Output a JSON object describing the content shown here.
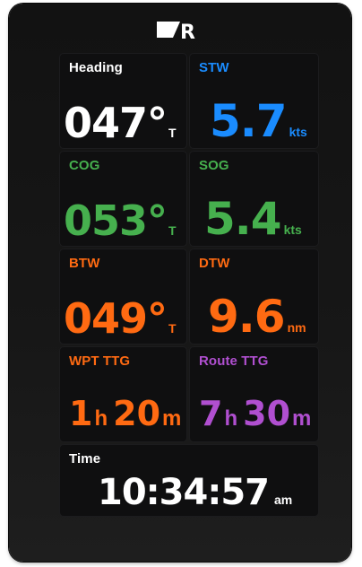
{
  "colors": {
    "white": "#ffffff",
    "blue": "#1a8cff",
    "green": "#46b04e",
    "orange": "#ff6a12",
    "purple": "#b04fd0"
  },
  "brand": {
    "logo_icon": "raymarine-logo-icon",
    "logo_letter": "R"
  },
  "tiles": {
    "heading": {
      "label": "Heading",
      "value": "047°",
      "unit": "T"
    },
    "stw": {
      "label": "STW",
      "value": "5.7",
      "unit": "kts"
    },
    "cog": {
      "label": "COG",
      "value": "053°",
      "unit": "T"
    },
    "sog": {
      "label": "SOG",
      "value": "5.4",
      "unit": "kts"
    },
    "btw": {
      "label": "BTW",
      "value": "049°",
      "unit": "T"
    },
    "dtw": {
      "label": "DTW",
      "value": "9.6",
      "unit": "nm"
    },
    "wpt_ttg": {
      "label": "WPT TTG",
      "hours": "1",
      "hours_unit": "h",
      "minutes": "20",
      "minutes_unit": "m"
    },
    "route_ttg": {
      "label": "Route TTG",
      "hours": "7",
      "hours_unit": "h",
      "minutes": "30",
      "minutes_unit": "m"
    },
    "time": {
      "label": "Time",
      "value": "10:34:57",
      "unit": "am"
    }
  }
}
